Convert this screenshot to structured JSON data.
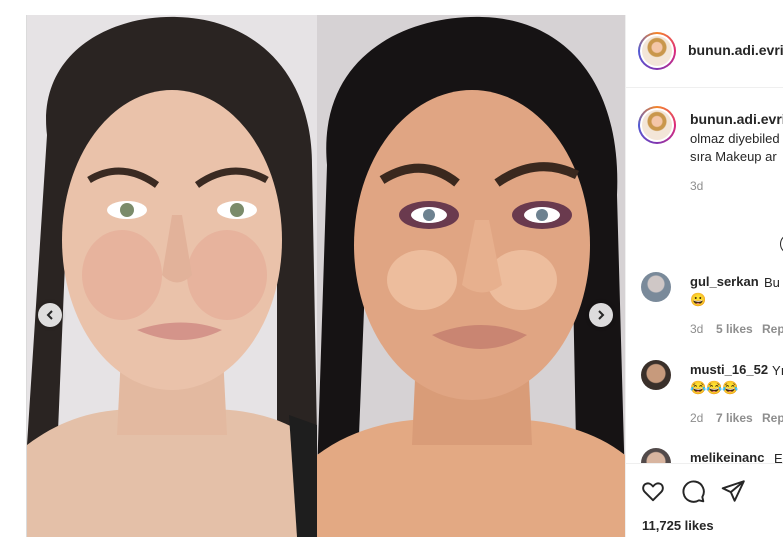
{
  "post": {
    "username": "bunun.adi.evrim",
    "caption": {
      "username": "bunun.adi.evrim",
      "line2": "olmaz diyebiled",
      "line3": "sıra Makeup ar",
      "time": "3d"
    },
    "likes": "11,725 likes"
  },
  "comments": [
    {
      "user": "gul_serkan",
      "text": "Bu",
      "emoji": "😀",
      "time": "3d",
      "likes": "5 likes",
      "reply": "Rep"
    },
    {
      "user": "musti_16_52",
      "text": "Yı",
      "emoji": "😂😂😂",
      "time": "2d",
      "likes": "7 likes",
      "reply": "Rep"
    },
    {
      "user": "melikeinanc",
      "text": "E"
    }
  ],
  "icons": {
    "prev": "chevron-left-icon",
    "next": "chevron-right-icon",
    "like": "heart-icon",
    "comment": "comment-icon",
    "share": "send-icon"
  },
  "colors": {
    "text": "#262626",
    "muted": "#8e8e8e",
    "border": "#dbdbdb"
  }
}
